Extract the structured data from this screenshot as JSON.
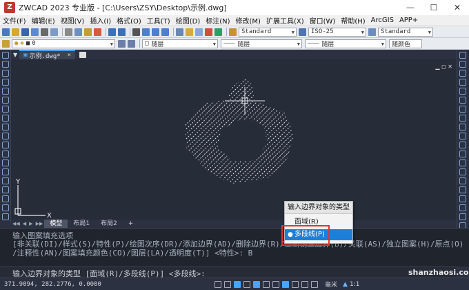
{
  "window": {
    "title": "ZWCAD 2023 专业版 - [C:\\Users\\ZSY\\Desktop\\示例.dwg]",
    "logo_letter": "Z"
  },
  "menu": [
    "文件(F)",
    "编辑(E)",
    "视图(V)",
    "插入(I)",
    "格式(O)",
    "工具(T)",
    "绘图(D)",
    "标注(N)",
    "修改(M)",
    "扩展工具(X)",
    "窗口(W)",
    "帮助(H)",
    "ArcGIS",
    "APP+"
  ],
  "toolbar1": {
    "text_style": "Standard",
    "dim_style": "ISO-25",
    "table_style": "Standard"
  },
  "toolbar2": {
    "layer": "0",
    "color": "随层",
    "linetype": "随层",
    "lineweight": "随层",
    "plot_style": "随颜色"
  },
  "doc_tab": {
    "label": "示例.dwg*",
    "close": "×"
  },
  "layout_tabs": [
    "模型",
    "布局1",
    "布局2",
    "+"
  ],
  "command": {
    "line1": "输入图案填充选项",
    "line2": "[非关联(DI)/样式(S)/特性(P)/绘图次序(DR)/添加边界(AD)/删除边界(R)/重新创建边界(B)/关联(AS)/独立图案(H)/原点(O)",
    "line3": "/注释性(AN)/图案填充颜色(CO)/图层(LA)/透明度(T)] <特性>: B",
    "input": "输入边界对象的类型 [面域(R)/多段线(P)] <多段线>:"
  },
  "context_menu": {
    "title": "输入边界对象的类型",
    "items": [
      "面域(R)",
      "多段线(P)"
    ],
    "selected_index": 1
  },
  "status": {
    "coords": "371.9094, 282.2776, 0.0000",
    "units": "毫米",
    "scale": "1:1"
  },
  "axis": {
    "x": "X",
    "y": "Y"
  },
  "watermark": "shanzhaosi.com",
  "colors": {
    "canvas": "#262c38",
    "hatch": "#d8dde6",
    "highlight": "#e23333",
    "accent": "#1e7fd8"
  }
}
